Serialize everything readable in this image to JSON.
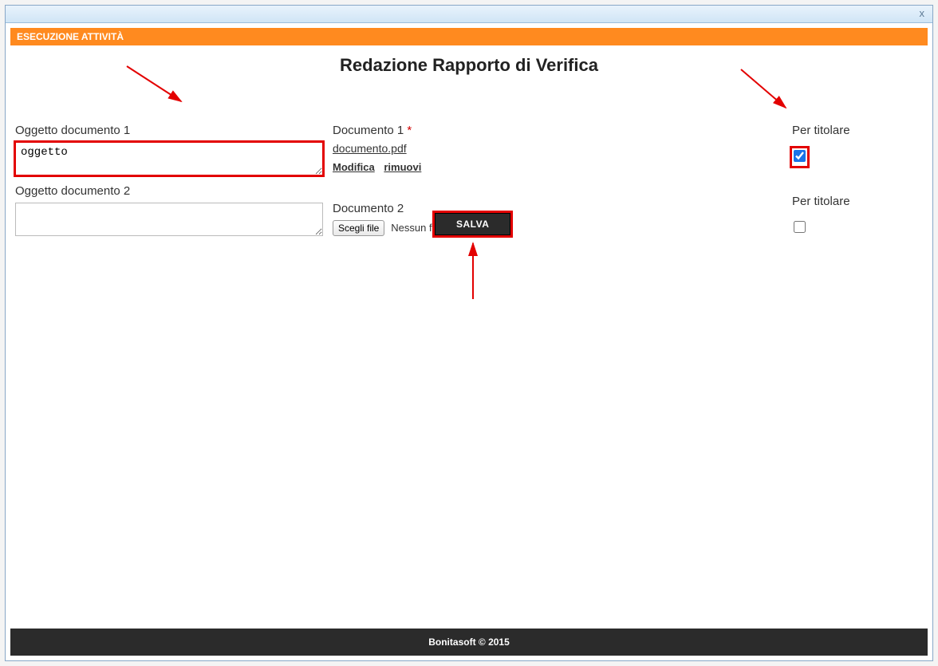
{
  "window": {
    "close_symbol": "x"
  },
  "panel": {
    "header": "ESECUZIONE ATTIVITÀ"
  },
  "page": {
    "title": "Redazione Rapporto di Verifica"
  },
  "form": {
    "oggetto1": {
      "label": "Oggetto documento 1",
      "value": "oggetto"
    },
    "oggetto2": {
      "label": "Oggetto documento 2",
      "value": ""
    },
    "documento1": {
      "label": "Documento 1",
      "required_marker": "*",
      "filename": "documento.pdf",
      "action_modify": "Modifica",
      "action_remove": "rimuovi"
    },
    "documento2": {
      "label": "Documento 2",
      "choose_file_btn": "Scegli file",
      "no_file_text": "Nessun file selezionato"
    },
    "titolare1": {
      "label": "Per titolare",
      "checked": true
    },
    "titolare2": {
      "label": "Per titolare",
      "checked": false
    },
    "save_btn": "SALVA"
  },
  "footer": {
    "text": "Bonitasoft © 2015"
  }
}
